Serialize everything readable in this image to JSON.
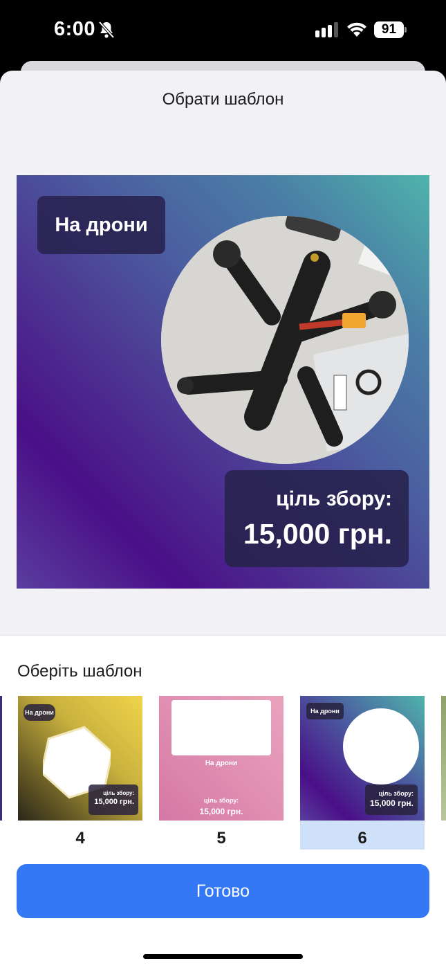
{
  "status_bar": {
    "time": "6:00",
    "battery": "91",
    "icons": [
      "bell-slash-icon",
      "signal-icon",
      "wifi-icon",
      "battery-icon"
    ]
  },
  "sheet": {
    "title": "Обрати шаблон"
  },
  "preview": {
    "title_tag": "На дрони",
    "goal_label": "ціль збору:",
    "goal_amount": "15,000 грн.",
    "photo": "drone-photo"
  },
  "templates": {
    "heading": "Оберіть шаблон",
    "selected": "6",
    "items": [
      {
        "number": "4",
        "title_tag": "На дрони",
        "goal_label": "ціль збору:",
        "goal_amount": "15,000 грн."
      },
      {
        "number": "5",
        "title_tag": "На дрони",
        "goal_label": "ціль збору:",
        "goal_amount": "15,000 грн."
      },
      {
        "number": "6",
        "title_tag": "На дрони",
        "goal_label": "ціль збору:",
        "goal_amount": "15,000 грн."
      }
    ]
  },
  "done_button": {
    "label": "Готово"
  },
  "colors": {
    "accent": "#3478f6",
    "selected_bg": "#cfe1f8",
    "sheet_bg": "#f1f1f6"
  }
}
